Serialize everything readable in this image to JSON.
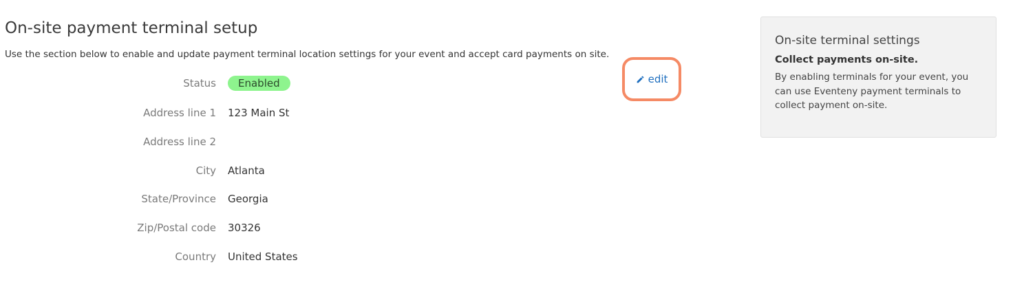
{
  "header": {
    "title": "On-site payment terminal setup",
    "description": "Use the section below to enable and update payment terminal location settings for your event and accept card payments on site."
  },
  "fields": {
    "status": {
      "label": "Status",
      "value": "Enabled"
    },
    "address1": {
      "label": "Address line 1",
      "value": "123 Main St"
    },
    "address2": {
      "label": "Address line 2",
      "value": ""
    },
    "city": {
      "label": "City",
      "value": "Atlanta"
    },
    "state": {
      "label": "State/Province",
      "value": "Georgia"
    },
    "zip": {
      "label": "Zip/Postal code",
      "value": "30326"
    },
    "country": {
      "label": "Country",
      "value": "United States"
    }
  },
  "edit": {
    "label": "edit",
    "icon": "pencil-icon",
    "highlight_color": "#f58a65",
    "link_color": "#1f6fbf"
  },
  "sidebar": {
    "title": "On-site terminal settings",
    "subtitle": "Collect payments on-site.",
    "text": "By enabling terminals for your event, you can use Eventeny payment terminals to collect payment on-site."
  },
  "colors": {
    "status_badge_bg": "#8ef48e",
    "sidebar_bg": "#f2f2f2"
  }
}
